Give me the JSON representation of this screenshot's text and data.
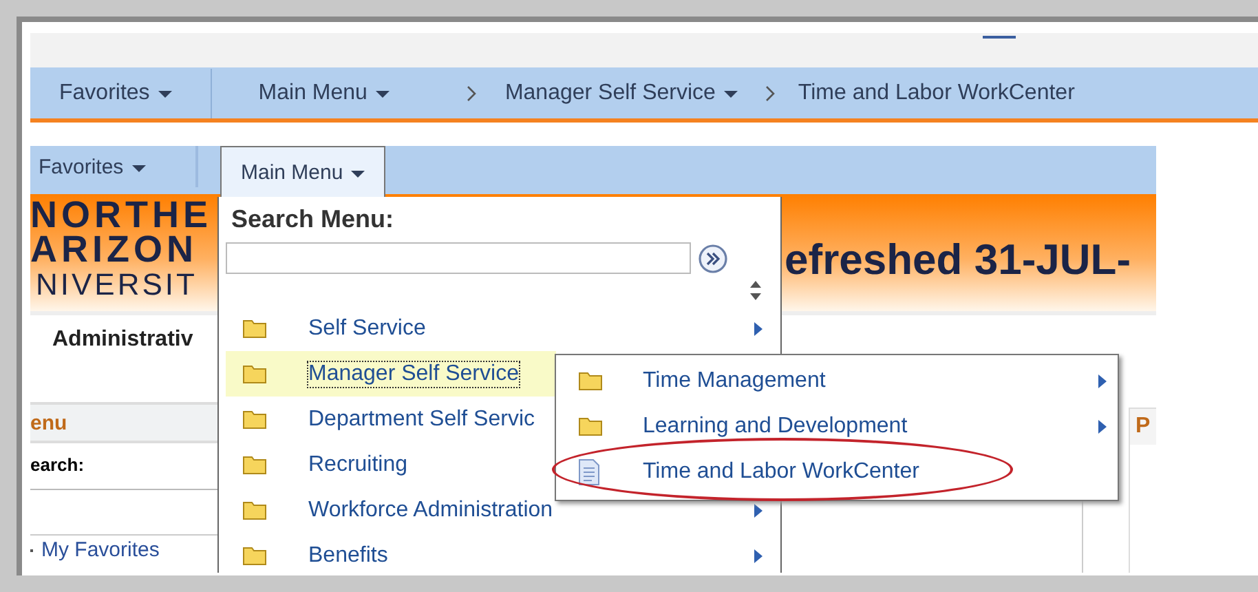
{
  "breadcrumb": [
    {
      "label": "Favorites",
      "dropdown": true,
      "separator": false
    },
    {
      "label": "Main Menu",
      "dropdown": true,
      "separator": false
    },
    {
      "label": "Manager Self Service",
      "dropdown": true,
      "separator": true
    },
    {
      "label": "Time and Labor WorkCenter",
      "dropdown": false,
      "separator": true
    }
  ],
  "inner_page": {
    "nav": [
      {
        "label": "Favorites",
        "selected": false
      },
      {
        "label": "Main Menu",
        "selected": true
      }
    ],
    "logo_lines": [
      "NORTHE",
      "ARIZON",
      "NIVERSIT"
    ],
    "banner_heading": "efreshed 31-JUL-",
    "section_title": "Administrativ",
    "left_menu": {
      "title": "enu",
      "search_label": "earch:",
      "links": [
        "My Favorites"
      ]
    },
    "right_panel": {
      "title": "P"
    }
  },
  "menu": {
    "title": "Search Menu:",
    "items": [
      {
        "label": "Self Service",
        "kind": "folder",
        "has_children": true,
        "selected": false
      },
      {
        "label": "Manager Self Service",
        "kind": "folder",
        "has_children": false,
        "selected": true
      },
      {
        "label": "Department Self Servic",
        "kind": "folder",
        "has_children": false,
        "selected": false
      },
      {
        "label": "Recruiting",
        "kind": "folder",
        "has_children": false,
        "selected": false
      },
      {
        "label": "Workforce Administration",
        "kind": "folder",
        "has_children": true,
        "selected": false
      },
      {
        "label": "Benefits",
        "kind": "folder",
        "has_children": true,
        "selected": false
      }
    ]
  },
  "submenu": {
    "items": [
      {
        "label": "Time Management",
        "kind": "folder",
        "has_children": true,
        "circled": false
      },
      {
        "label": "Learning and Development",
        "kind": "folder",
        "has_children": true,
        "circled": false
      },
      {
        "label": "Time and Labor WorkCenter",
        "kind": "document",
        "has_children": false,
        "circled": true
      }
    ]
  }
}
